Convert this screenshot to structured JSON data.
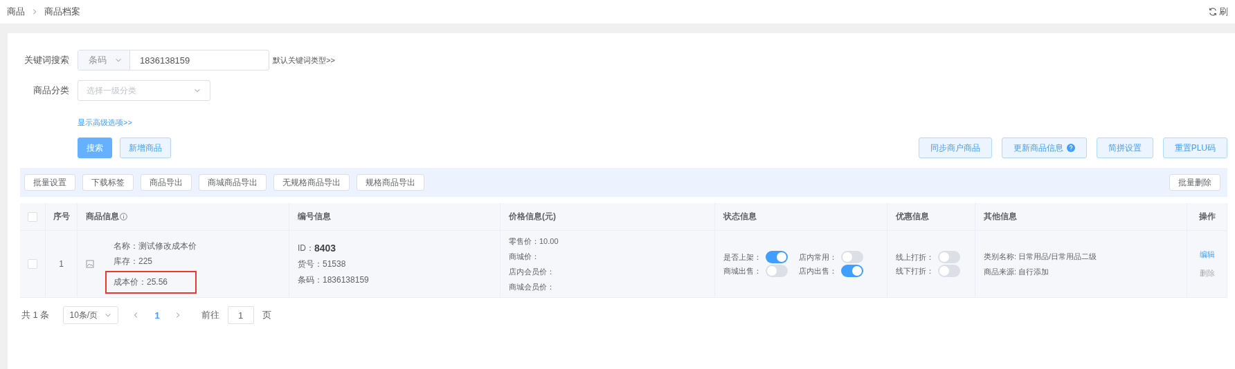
{
  "breadcrumb": [
    "商品",
    "商品档案"
  ],
  "refresh": {
    "label": "刷"
  },
  "filters": {
    "keyword": {
      "label": "关键词搜索",
      "type_select": "条码",
      "value": "1836138159",
      "hint_link": "默认关键词类型>>"
    },
    "category": {
      "label": "商品分类",
      "placeholder": "选择一级分类"
    },
    "advanced_link": "显示高级选项>>"
  },
  "actions": [
    {
      "label": "搜索",
      "kind": "primary"
    },
    {
      "label": "新增商品",
      "kind": "plain"
    }
  ],
  "right_actions": [
    {
      "label": "同步商户商品",
      "help": false
    },
    {
      "label": "更新商品信息",
      "help": true
    },
    {
      "label": "简拼设置",
      "help": false
    },
    {
      "label": "重置PLU码",
      "help": false
    }
  ],
  "toolbar": [
    "批量设置",
    "下载标签",
    "商品导出",
    "商城商品导出",
    "无规格商品导出",
    "规格商品导出"
  ],
  "toolbar_right": "批量删除",
  "table": {
    "header_checked": false,
    "columns": [
      "序号",
      "商品信息",
      "编号信息",
      "价格信息(元)",
      "状态信息",
      "优惠信息",
      "其他信息",
      "操作"
    ],
    "rows": [
      {
        "checked": false,
        "index": "1",
        "product": {
          "name": "名称：测试修改成本价",
          "stock": "库存：225",
          "cost": "成本价：25.56",
          "cost_highlighted": true
        },
        "codes": {
          "id_label": "ID：",
          "id": "8403",
          "sku": "货号：51538",
          "barcode": "条码：1836138159"
        },
        "prices": [
          "零售价：10.00",
          "商城价：",
          "店内会员价：",
          "商城会员价："
        ],
        "status": [
          {
            "label": "是否上架：",
            "on": true
          },
          {
            "label": "店内常用：",
            "on": false
          },
          {
            "label": "商城出售：",
            "on": false
          },
          {
            "label": "店内出售：",
            "on": true
          }
        ],
        "discounts": [
          {
            "label": "线上打折：",
            "on": false
          },
          {
            "label": "线下打折：",
            "on": false
          }
        ],
        "other": [
          "类别名称: 日常用品/日常用品二级",
          "商品来源: 自行添加"
        ],
        "ops": [
          {
            "label": "编辑",
            "kind": "link"
          },
          {
            "label": "删除",
            "kind": "muted"
          }
        ]
      }
    ]
  },
  "pagination": {
    "total": "共 1 条",
    "page_size": "10条/页",
    "pages": [
      {
        "label": "1",
        "selected": true
      }
    ],
    "goto_label": "前往",
    "goto_value": "1",
    "goto_suffix": "页"
  }
}
